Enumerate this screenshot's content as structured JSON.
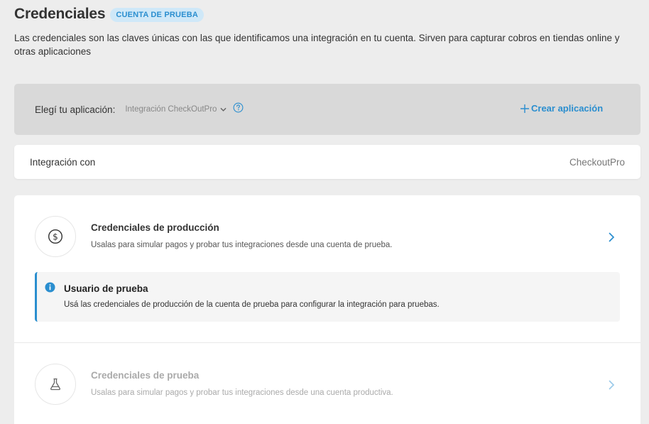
{
  "header": {
    "title": "Credenciales",
    "badge": "CUENTA DE PRUEBA",
    "description": "Las credenciales son las claves únicas con las que identificamos una integración en tu cuenta. Sirven para capturar cobros en tiendas online y otras aplicaciones"
  },
  "app_selector": {
    "label": "Elegí tu aplicación:",
    "selected": "Integración CheckOutPro",
    "help_icon": "question-circle-icon",
    "create_label": "Crear aplicación",
    "create_icon": "plus-icon"
  },
  "integration": {
    "label": "Integración con",
    "value": "CheckoutPro"
  },
  "credentials": {
    "production": {
      "icon": "dollar-circle-icon",
      "title": "Credenciales de producción",
      "subtitle": "Usalas para simular pagos y probar tus integraciones desde una cuenta de prueba."
    },
    "notice": {
      "icon": "info-icon",
      "title": "Usuario de prueba",
      "text": "Usá las credenciales de producción de la cuenta de prueba para configurar la integración para pruebas."
    },
    "test": {
      "icon": "flask-icon",
      "title": "Credenciales de prueba",
      "subtitle": "Usalas para simular pagos y probar tus integraciones desde una cuenta productiva."
    }
  },
  "colors": {
    "accent": "#2a8ecf",
    "badge_bg": "#cfe8f8",
    "background": "#ededed"
  }
}
